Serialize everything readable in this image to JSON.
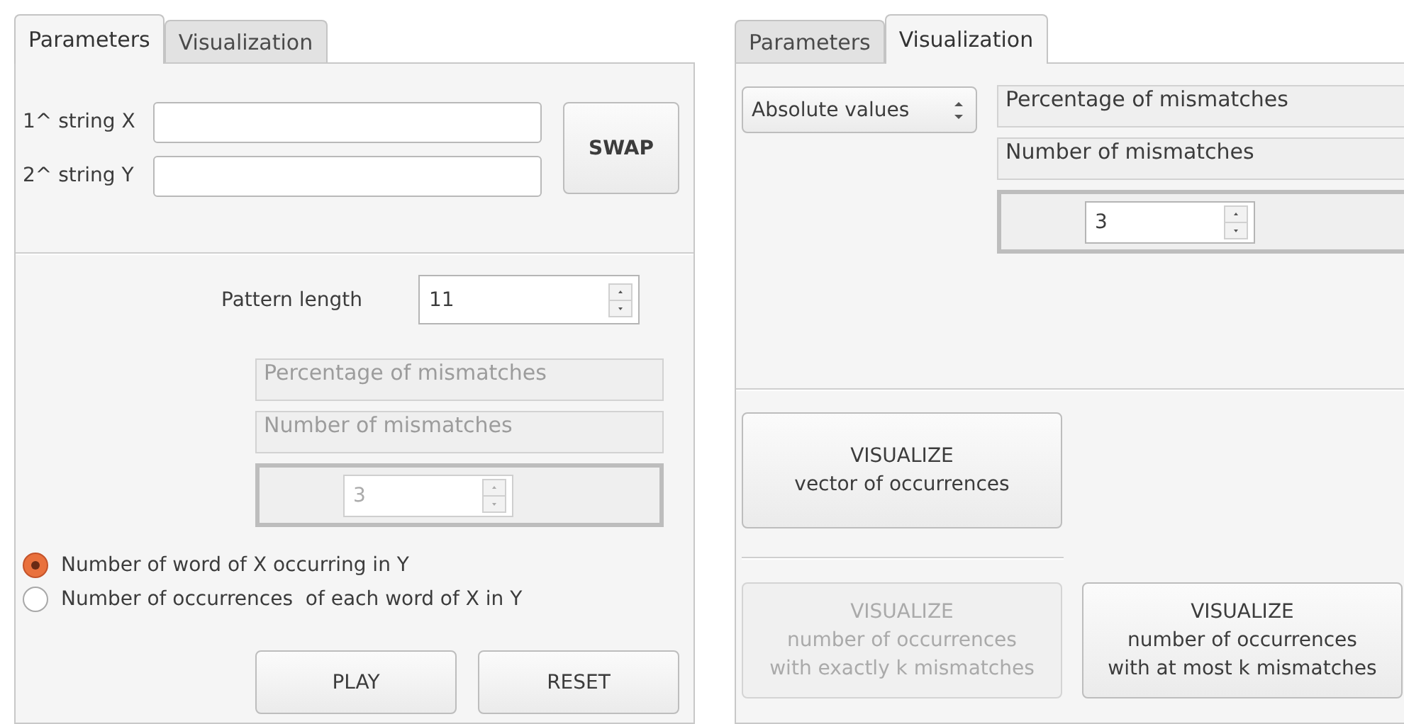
{
  "parameters_panel": {
    "tabs": [
      {
        "label": "Parameters",
        "selected": true
      },
      {
        "label": "Visualization",
        "selected": false
      }
    ],
    "strings": [
      {
        "label": "1^ string X"
      },
      {
        "label": "2^ string Y"
      }
    ],
    "swap_button": "SWAP",
    "pattern_length": {
      "label": "Pattern length",
      "value": "11"
    },
    "mismatch_options": {
      "disabled": true,
      "headers": [
        "Percentage of mismatches",
        "Number of mismatches"
      ],
      "value": "3"
    },
    "radios": [
      {
        "label": "Number of word of X occurring in Y",
        "selected": true
      },
      {
        "label": "Number of occurrences  of each word of X in Y",
        "selected": false
      }
    ],
    "buttons": [
      "PLAY",
      "RESET"
    ]
  },
  "visualization_panel": {
    "tabs": [
      {
        "label": "Parameters",
        "selected": false
      },
      {
        "label": "Visualization",
        "selected": true
      }
    ],
    "mode_select": "Absolute values",
    "mismatch_options": {
      "disabled": false,
      "headers": [
        "Percentage of mismatches",
        "Number of mismatches"
      ],
      "value": "3"
    },
    "vector_button": {
      "label": "VISUALIZE\nvector of occurrences",
      "disabled": false
    },
    "buttons": [
      {
        "label": "VISUALIZE\nnumber of occurrences\nwith exactly k mismatches",
        "disabled": true
      },
      {
        "label": "VISUALIZE\nnumber of occurrences\nwith at most k mismatches",
        "disabled": false
      }
    ]
  }
}
